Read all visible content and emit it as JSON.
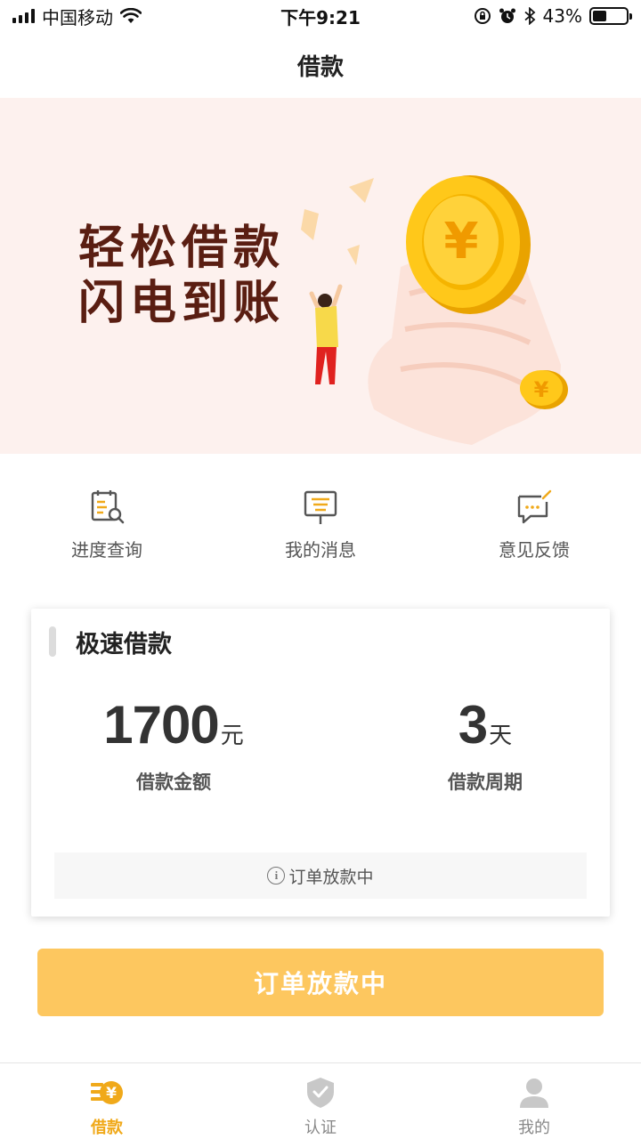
{
  "status_bar": {
    "carrier": "中国移动",
    "time": "下午9:21",
    "battery_percent": "43%",
    "battery_level": 0.43
  },
  "nav": {
    "title": "借款"
  },
  "banner": {
    "line1": "轻松借款",
    "line2": "闪电到账"
  },
  "quick_links": [
    {
      "label": "进度查询",
      "icon": "progress-search-icon"
    },
    {
      "label": "我的消息",
      "icon": "message-icon"
    },
    {
      "label": "意见反馈",
      "icon": "feedback-icon"
    }
  ],
  "card": {
    "title": "极速借款",
    "amount_value": "1700",
    "amount_unit": "元",
    "amount_label": "借款金额",
    "period_value": "3",
    "period_unit": "天",
    "period_label": "借款周期",
    "notice": "订单放款中"
  },
  "primary_button": {
    "label": "订单放款中"
  },
  "tabs": [
    {
      "label": "借款",
      "icon": "loan-icon",
      "active": true
    },
    {
      "label": "认证",
      "icon": "shield-check-icon",
      "active": false
    },
    {
      "label": "我的",
      "icon": "user-icon",
      "active": false
    }
  ],
  "colors": {
    "accent": "#f0a91a",
    "button": "#fdc75f",
    "banner_bg": "#fdf1ee",
    "banner_text": "#5a1e12"
  }
}
